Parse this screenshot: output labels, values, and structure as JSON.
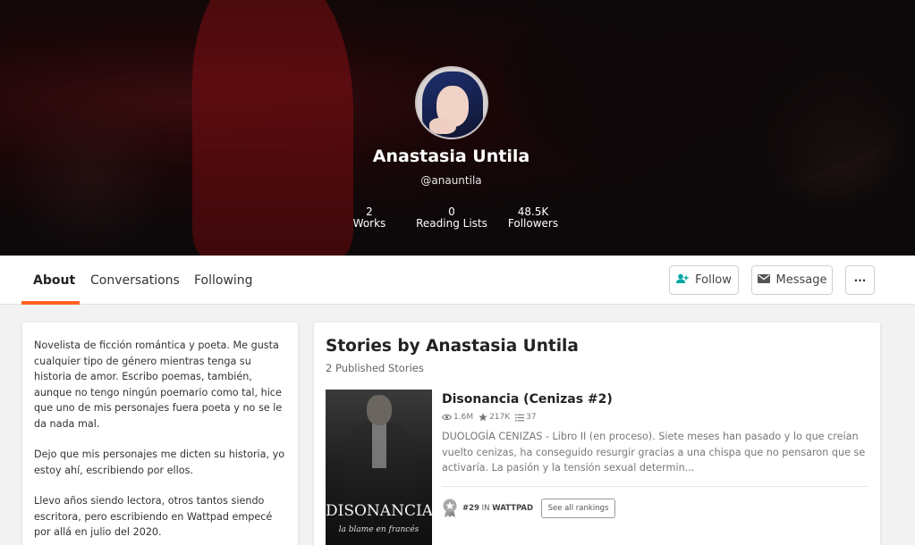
{
  "profile": {
    "name": "Anastasia Untila",
    "handle": "@anauntila",
    "stats": [
      {
        "value": "2",
        "label": "Works"
      },
      {
        "value": "0",
        "label": "Reading Lists"
      },
      {
        "value": "48.5K",
        "label": "Followers"
      }
    ]
  },
  "tabs": [
    {
      "label": "About"
    },
    {
      "label": "Conversations"
    },
    {
      "label": "Following"
    }
  ],
  "actions": {
    "follow": "Follow",
    "message": "Message",
    "more": "···"
  },
  "about": {
    "paragraphs": [
      "Novelista de ficción romántica y poeta. Me gusta cualquier tipo de género mientras tenga su historia de amor. Escribo poemas, también, aunque no tengo ningún poemario como tal, hice que uno de mis personajes fuera poeta y no se le da nada mal.",
      "Dejo que mis personajes me dicten su historia, yo estoy ahí, escribiendo por ellos.",
      "Llevo años siendo lectora, otros tantos siendo escritora, pero escribiendo en Wattpad empecé por allá en julio del 2020."
    ]
  },
  "stories": {
    "title": "Stories by Anastasia Untila",
    "subtitle": "2 Published Stories",
    "items": [
      {
        "title": "Disonancia (Cenizas #2)",
        "reads": "1.6M",
        "votes": "217K",
        "parts": "37",
        "description": "DUOLOGÍA CENIZAS - Libro II (en proceso). Siete meses han pasado y lo que creían vuelto cenizas, ha conseguido resurgir gracias a una chispa que no pensaron que se activaría. La pasión y la tensión sexual determin...",
        "cover_title": "DISONANCIA",
        "cover_subtitle": "la blame en francés",
        "rank_number": "#29",
        "rank_in": "IN",
        "rank_place": "WATTPAD",
        "rankings_button": "See all rankings"
      }
    ]
  },
  "colors": {
    "accent": "#ff6122",
    "follow_icon": "#00a5a5"
  },
  "icons": {
    "reads": "eye-icon",
    "votes": "star-icon",
    "parts": "list-icon",
    "follow": "add-person-icon",
    "message": "envelope-icon",
    "rank": "medal-icon"
  }
}
